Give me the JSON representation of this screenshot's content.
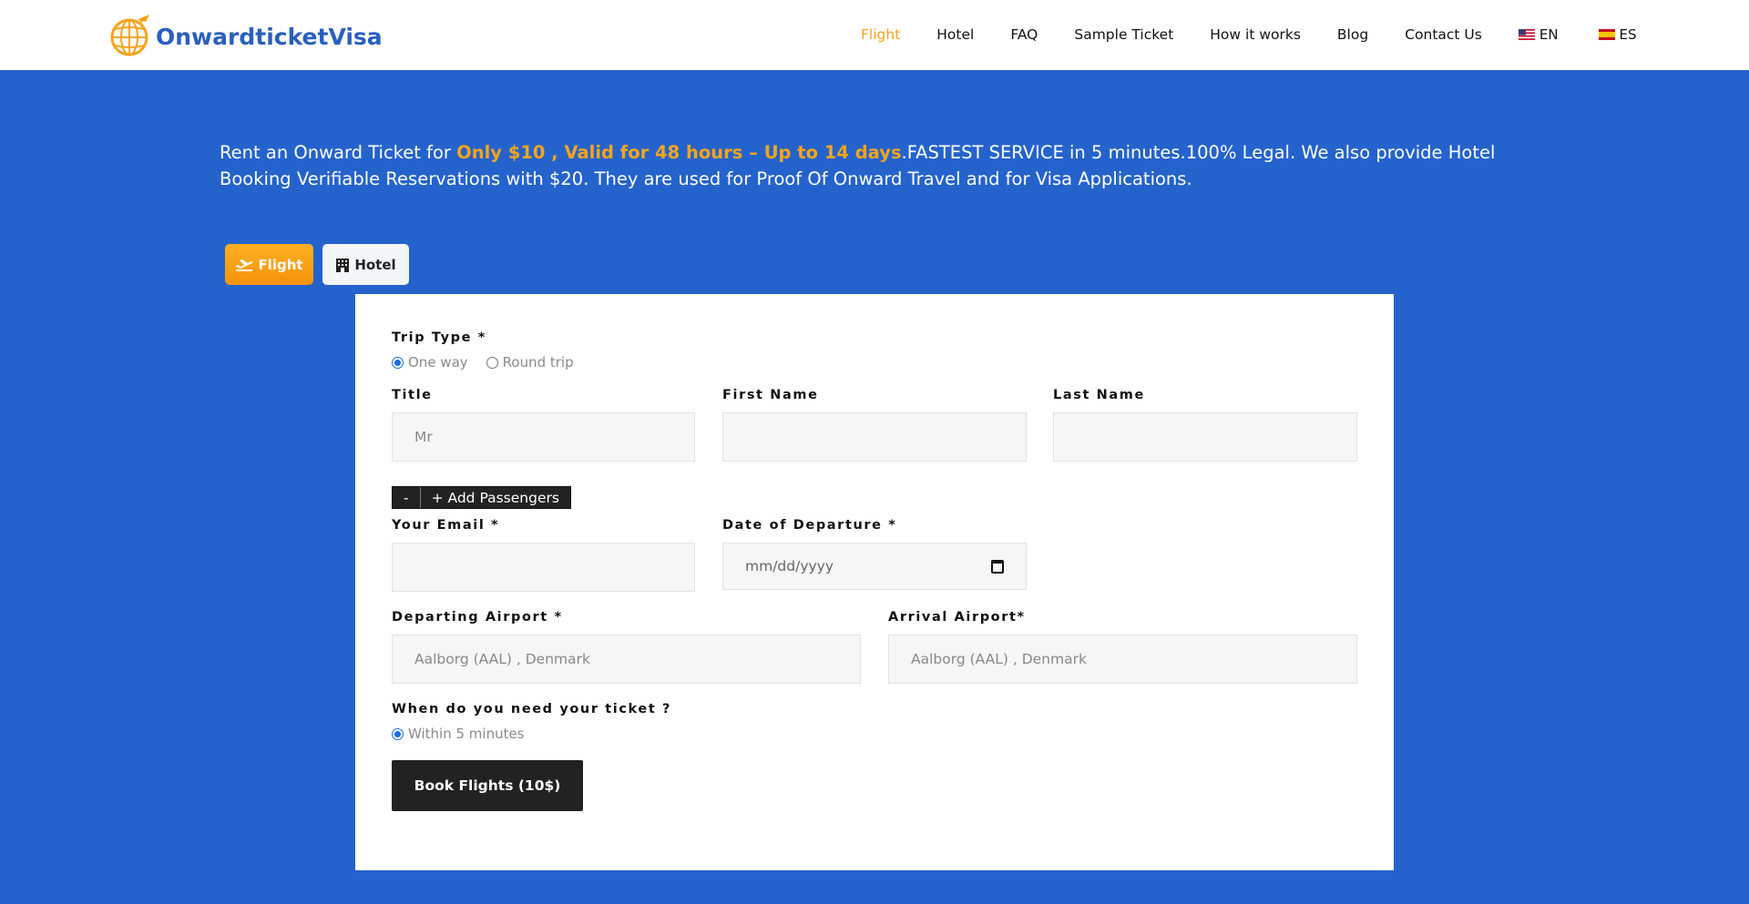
{
  "brand": {
    "name": "OnwardticketVisa",
    "accent": "#f5a41b",
    "primary": "#2563cc"
  },
  "nav": {
    "items": [
      "Flight",
      "Hotel",
      "FAQ",
      "Sample Ticket",
      "How it works",
      "Blog",
      "Contact Us"
    ],
    "active": "Flight",
    "languages": [
      {
        "code": "EN",
        "flag": "us-flag-icon"
      },
      {
        "code": "ES",
        "flag": "es-flag-icon"
      }
    ]
  },
  "intro": {
    "prefix": "Rent an Onward Ticket for ",
    "highlight": "Only $10 , Valid for 48 hours – Up to 14 days",
    "suffix": ".FASTEST SERVICE in 5 minutes.100% Legal. We also provide Hotel Booking Verifiable Reservations with $20. They are used for Proof Of Onward Travel and for Visa Applications."
  },
  "tabs": {
    "flight": "Flight",
    "hotel": "Hotel",
    "active": "flight"
  },
  "form": {
    "trip_type": {
      "label": "Trip Type *",
      "options": [
        "One way",
        "Round trip"
      ],
      "selected": "One way"
    },
    "title": {
      "label": "Title",
      "value": "Mr"
    },
    "first_name": {
      "label": "First Name",
      "value": ""
    },
    "last_name": {
      "label": "Last Name",
      "value": ""
    },
    "passengers": {
      "minus": "-",
      "add": "+ Add Passengers"
    },
    "email": {
      "label": "Your Email *",
      "value": ""
    },
    "departure_date": {
      "label": "Date of Departure *",
      "placeholder": "mm/dd/yyyy"
    },
    "departing_airport": {
      "label": "Departing Airport *",
      "value": "Aalborg (AAL) , Denmark"
    },
    "arrival_airport": {
      "label": "Arrival Airport*",
      "value": "Aalborg (AAL) , Denmark"
    },
    "ticket_timing": {
      "label": "When do you need your ticket ?",
      "options": [
        "Within 5 minutes"
      ],
      "selected": "Within 5 minutes"
    },
    "submit": "Book Flights (10$)"
  }
}
